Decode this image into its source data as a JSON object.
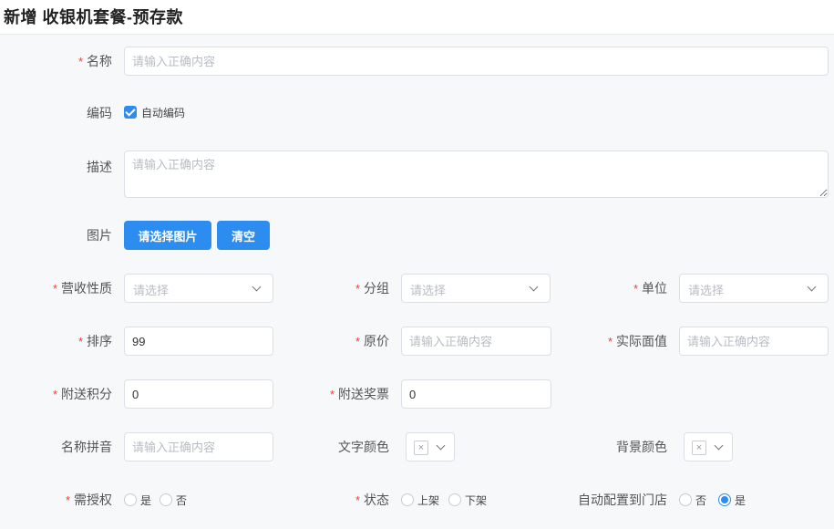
{
  "page": {
    "title": "新增 收银机套餐-预存款"
  },
  "form": {
    "required_mark": "*",
    "name": {
      "label": "名称",
      "placeholder": "请输入正确内容",
      "value": ""
    },
    "code": {
      "label": "编码",
      "auto_label": "自动编码",
      "checked": true
    },
    "description": {
      "label": "描述",
      "placeholder": "请输入正确内容"
    },
    "image": {
      "label": "图片",
      "select_button": "请选择图片",
      "clear_button": "清空"
    },
    "revenue_type": {
      "label": "营收性质",
      "placeholder": "请选择"
    },
    "group": {
      "label": "分组",
      "placeholder": "请选择"
    },
    "unit": {
      "label": "单位",
      "placeholder": "请选择"
    },
    "sort": {
      "label": "排序",
      "value": "99"
    },
    "original_price": {
      "label": "原价",
      "placeholder": "请输入正确内容"
    },
    "face_value": {
      "label": "实际面值",
      "placeholder": "请输入正确内容"
    },
    "bonus_points": {
      "label": "附送积分",
      "value": "0"
    },
    "bonus_tickets": {
      "label": "附送奖票",
      "value": "0"
    },
    "name_pinyin": {
      "label": "名称拼音",
      "placeholder": "请输入正确内容"
    },
    "text_color": {
      "label": "文字颜色",
      "icon": "empty-color-swatch"
    },
    "bg_color": {
      "label": "背景颜色",
      "icon": "empty-color-swatch"
    },
    "need_auth": {
      "label": "需授权",
      "options": [
        "是",
        "否"
      ],
      "selected": null
    },
    "status": {
      "label": "状态",
      "options": [
        "上架",
        "下架"
      ],
      "selected": null
    },
    "auto_config": {
      "label": "自动配置到门店",
      "options": [
        "否",
        "是"
      ],
      "selected": "是"
    }
  },
  "colors": {
    "primary": "#2d8cf0",
    "required": "#f04134",
    "border": "#dcdfe6"
  }
}
